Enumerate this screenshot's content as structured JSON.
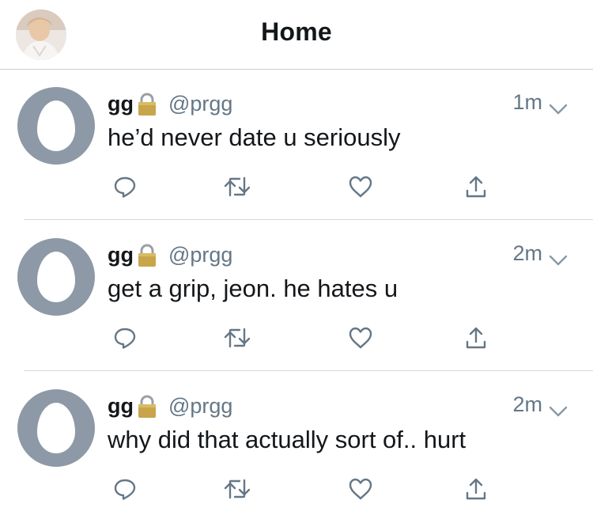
{
  "header": {
    "title": "Home",
    "avatar_icon": "profile-photo"
  },
  "tweets": [
    {
      "name": "gg",
      "handle": "@prgg",
      "time": "1m",
      "text": "he’d never date u seriously"
    },
    {
      "name": "gg",
      "handle": "@prgg",
      "time": "2m",
      "text": "get a grip, jeon. he hates u"
    },
    {
      "name": "gg",
      "handle": "@prgg",
      "time": "2m",
      "text": "why did that actually sort of.. hurt"
    }
  ],
  "icons": {
    "reply": "reply-icon",
    "retweet": "retweet-icon",
    "like": "heart-icon",
    "share": "share-icon",
    "protected": "lock-icon",
    "menu": "chevron-down-icon"
  },
  "colors": {
    "text": "#14171a",
    "secondary": "#657786",
    "icon": "#657786",
    "avatar_bg": "#8d99a6",
    "divider": "#d5d9dd"
  }
}
